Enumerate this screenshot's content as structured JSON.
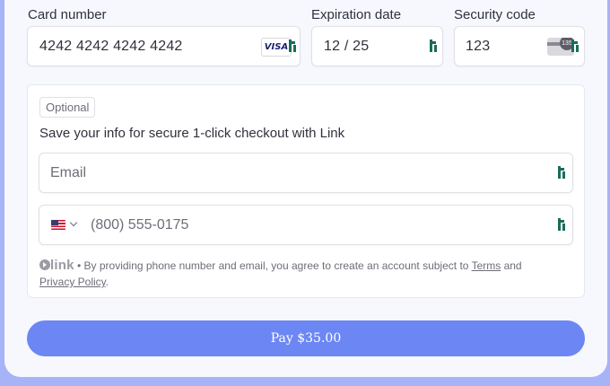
{
  "card_number": {
    "label": "Card number",
    "value": "4242 4242 4242 4242",
    "brand": "VISA"
  },
  "expiration": {
    "label": "Expiration date",
    "value": "12 / 25"
  },
  "security_code": {
    "label": "Security code",
    "value": "123",
    "card_back_digits": "135"
  },
  "link_section": {
    "badge": "Optional",
    "heading": "Save your info for secure 1-click checkout with Link",
    "email_placeholder": "Email",
    "phone_placeholder": "(800) 555-0175",
    "link_word": "link",
    "legal_prefix": " • By providing phone number and email, you agree to create an account subject to ",
    "terms_link": "Terms",
    "legal_and": " and",
    "privacy_link": "Privacy Policy",
    "legal_end": "."
  },
  "pay_button": {
    "label": "Pay $35.00"
  },
  "colors": {
    "accent": "#6c87f3",
    "link_green": "#1a6b5a",
    "visa_blue": "#1a1f71"
  }
}
